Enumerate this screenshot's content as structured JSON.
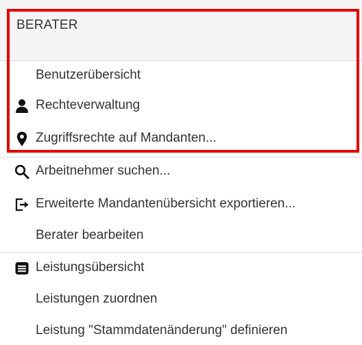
{
  "menu": {
    "header": {
      "label": "BERATER"
    },
    "items": [
      {
        "label": "Benutzerübersicht",
        "icon": ""
      },
      {
        "label": "Rechteverwaltung",
        "icon": "person-icon"
      },
      {
        "label": "Zugriffsrechte auf Mandanten...",
        "icon": "map-pin-icon"
      },
      {
        "label": "Arbeitnehmer suchen...",
        "icon": "search-icon"
      },
      {
        "label": "Erweiterte Mandantenübersicht exportieren...",
        "icon": "export-icon"
      },
      {
        "label": "Berater bearbeiten",
        "icon": ""
      },
      {
        "label": "Leistungsübersicht",
        "icon": "list-icon"
      },
      {
        "label": "Leistungen zuordnen",
        "icon": ""
      },
      {
        "label": "Leistung \"Stammdatenänderung\" definieren",
        "icon": ""
      }
    ]
  },
  "colors": {
    "highlight": "#e60000",
    "header_bg": "#f5f5f5",
    "text": "#333333",
    "divider": "#d9d9d9",
    "icon": "#111111"
  }
}
